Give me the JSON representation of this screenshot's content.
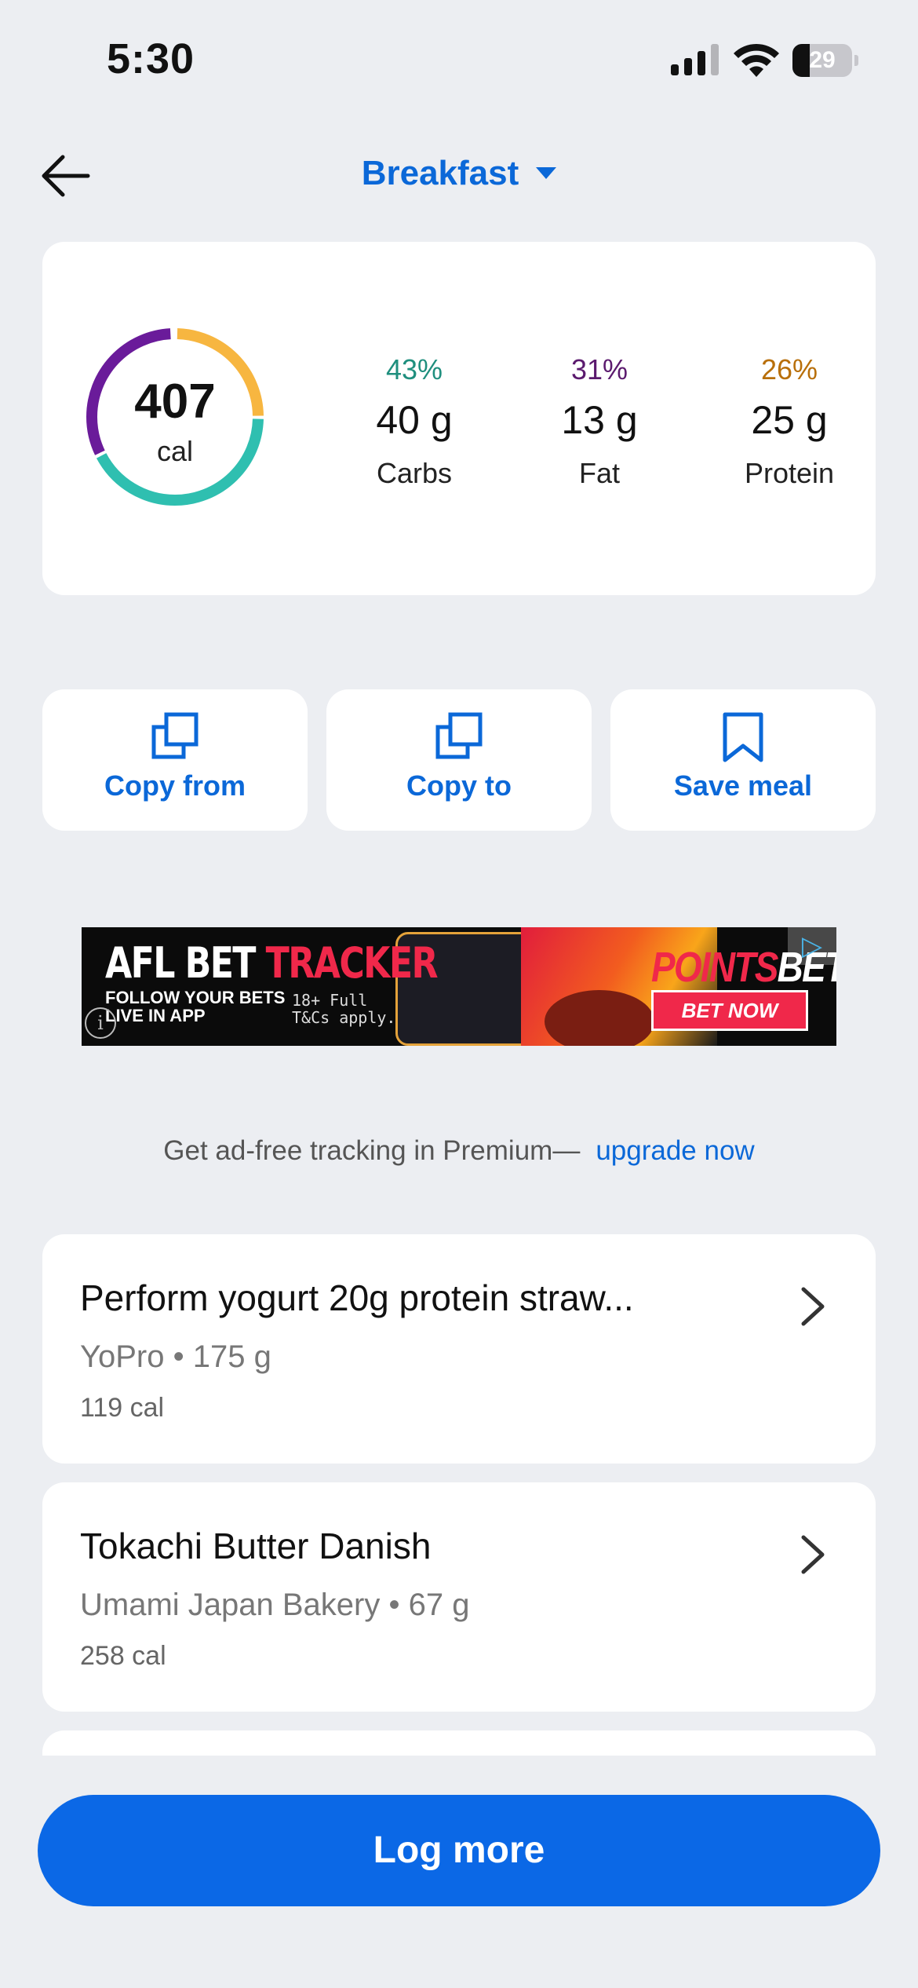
{
  "status_bar": {
    "time": "5:30",
    "battery": "29"
  },
  "nav": {
    "title": "Breakfast"
  },
  "summary": {
    "calories": "407",
    "calories_unit": "cal",
    "macros": [
      {
        "percent": "43%",
        "grams": "40 g",
        "label": "Carbs",
        "color": "#1f8f7e"
      },
      {
        "percent": "31%",
        "grams": "13 g",
        "label": "Fat",
        "color": "#5b1a6e"
      },
      {
        "percent": "26%",
        "grams": "25 g",
        "label": "Protein",
        "color": "#b86f0a"
      }
    ],
    "ring_colors": {
      "carbs": "#2fbfb0",
      "fat": "#6a1b9a",
      "protein": "#f7b640"
    }
  },
  "actions": [
    {
      "label": "Copy from",
      "icon": "copy-icon"
    },
    {
      "label": "Copy to",
      "icon": "copy-icon"
    },
    {
      "label": "Save meal",
      "icon": "bookmark-icon"
    }
  ],
  "ad": {
    "headline_white": "AFL BET",
    "headline_red": "TRACKER",
    "subline1": "FOLLOW YOUR BETS",
    "subline2": "LIVE IN APP",
    "terms1": "18+ Full",
    "terms2": "T&Cs apply.",
    "brand_red": "POINTS",
    "brand_white": "BET",
    "cta": "BET NOW"
  },
  "premium": {
    "text": "Get ad-free tracking in Premium—",
    "link": "upgrade now"
  },
  "foods": [
    {
      "name": "Perform yogurt 20g protein straw...",
      "meta": "YoPro • 175 g",
      "calories": "119 cal"
    },
    {
      "name": "Tokachi Butter Danish",
      "meta": "Umami Japan Bakery • 67 g",
      "calories": "258 cal"
    }
  ],
  "log_more": "Log more",
  "colors": {
    "accent": "#0b68d8",
    "background": "#eceef2"
  }
}
